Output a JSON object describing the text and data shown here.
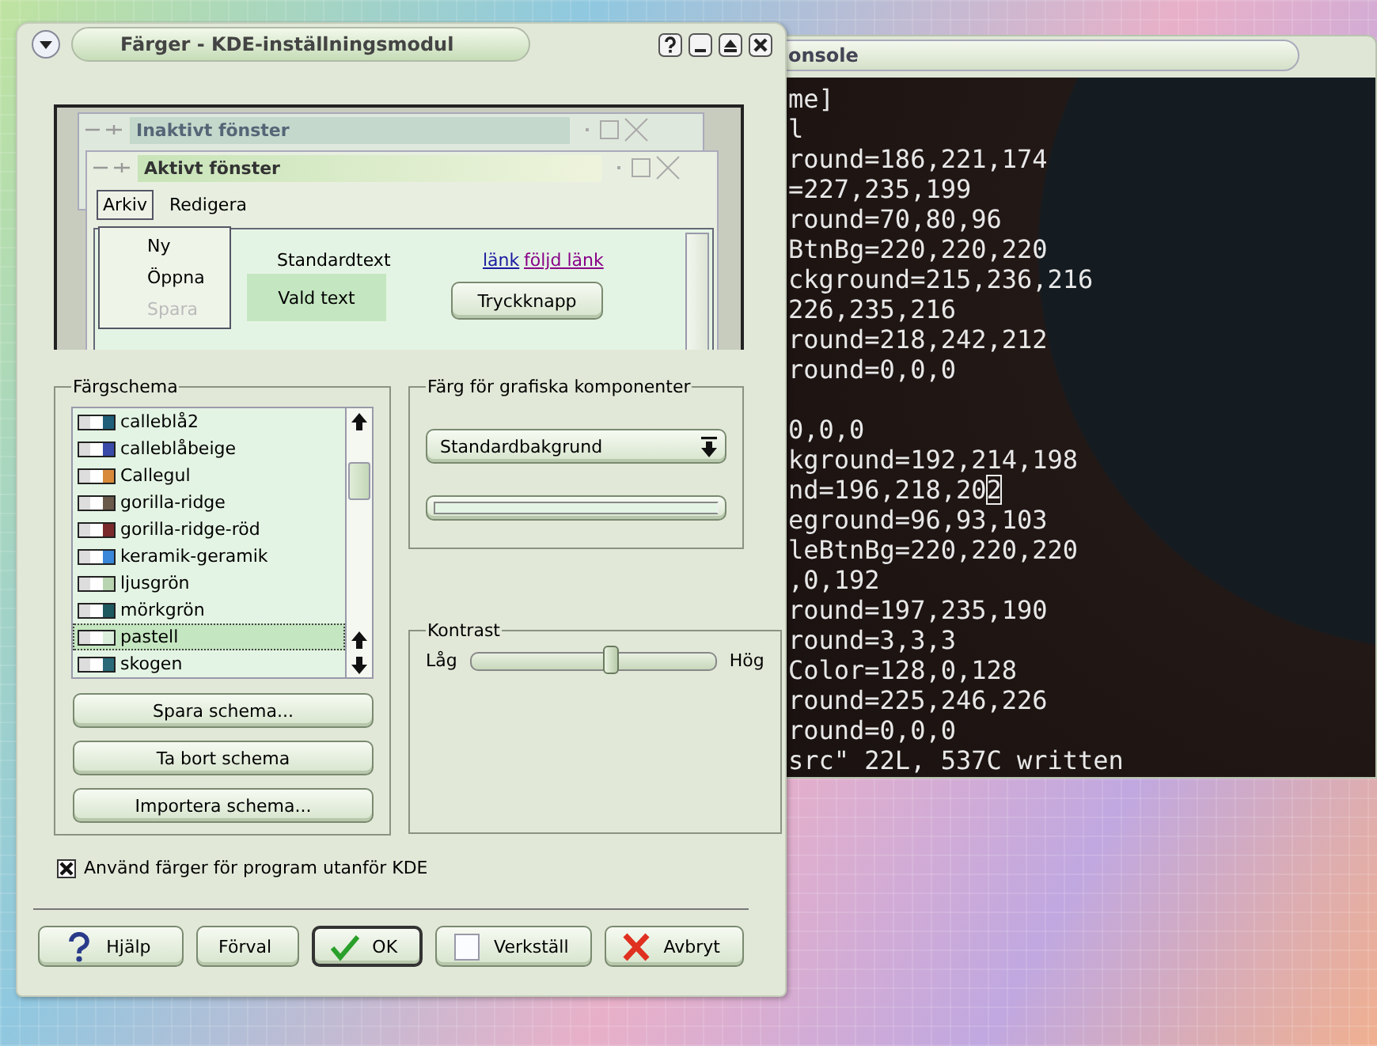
{
  "dialog": {
    "title": "Färger - KDE-inställningsmodul",
    "preview": {
      "inactive_title": "Inaktivt fönster",
      "active_title": "Aktivt fönster",
      "menu": [
        {
          "label": "Arkiv",
          "selected": true
        },
        {
          "label": "Redigera",
          "selected": false
        }
      ],
      "menu_items": [
        {
          "label": "Ny",
          "disabled": false
        },
        {
          "label": "Öppna",
          "disabled": false
        },
        {
          "label": "Spara",
          "disabled": true
        }
      ],
      "standard_text": "Standardtext",
      "selected_text": "Vald text",
      "link": "länk",
      "visited_link": "följd länk",
      "push_button": "Tryckknapp"
    },
    "scheme": {
      "title": "Färgschema",
      "items": [
        {
          "label": "calleblå2",
          "color": "#1f5f7a",
          "selected": false
        },
        {
          "label": "calleblåbeige",
          "color": "#3a4aa8",
          "selected": false
        },
        {
          "label": "Callegul",
          "color": "#d88a3a",
          "selected": false
        },
        {
          "label": "gorilla-ridge",
          "color": "#6a5a4c",
          "selected": false
        },
        {
          "label": "gorilla-ridge-röd",
          "color": "#7a2a2a",
          "selected": false
        },
        {
          "label": "keramik-geramik",
          "color": "#3a86d8",
          "selected": false
        },
        {
          "label": "ljusgrön",
          "color": "#b8d4b0",
          "selected": false
        },
        {
          "label": "mörkgrön",
          "color": "#1d5a60",
          "selected": false
        },
        {
          "label": "pastell",
          "color": "#dbeedc",
          "selected": true
        },
        {
          "label": "skogen",
          "color": "#2a6a78",
          "selected": false
        }
      ],
      "buttons": [
        "Spara schema...",
        "Ta bort schema",
        "Importera schema..."
      ]
    },
    "widget_color": {
      "title": "Färg för grafiska komponenter",
      "combo": "Standardbakgrund"
    },
    "contrast": {
      "title": "Kontrast",
      "low": "Låg",
      "high": "Hög",
      "level": 0.57
    },
    "use_colors": {
      "label": "Använd färger för program utanför KDE",
      "checked": true
    },
    "buttons": [
      {
        "label": "Hjälp",
        "kind": "help",
        "default": false
      },
      {
        "label": "Förval",
        "kind": "plain",
        "default": false
      },
      {
        "label": "OK",
        "kind": "ok",
        "default": true
      },
      {
        "label": "Verkställ",
        "kind": "apply",
        "default": false
      },
      {
        "label": "Avbryt",
        "kind": "cancel",
        "default": false
      }
    ]
  },
  "console": {
    "title": "onsole",
    "blocks": [
      [
        {
          "text": "me]"
        },
        {
          "text": "l"
        },
        {
          "text": "round=186,221,174"
        },
        {
          "text": "=227,235,199"
        },
        {
          "text": "round=70,80,96"
        },
        {
          "text": "BtnBg=220,220,220"
        },
        {
          "text": "ckground=215,236,216"
        },
        {
          "text": "226,235,216"
        },
        {
          "text": "round=218,242,212"
        },
        {
          "text": "round=0,0,0"
        }
      ],
      [
        {
          "text": "0,0,0"
        },
        {
          "text": "kground=192,214,198"
        },
        {
          "text": "nd=196,218,20",
          "cursor": "2"
        },
        {
          "text": "eground=96,93,103"
        },
        {
          "text": "leBtnBg=220,220,220"
        },
        {
          "text": ",0,192"
        },
        {
          "text": "round=197,235,190"
        },
        {
          "text": "round=3,3,3"
        },
        {
          "text": "Color=128,0,128"
        },
        {
          "text": "round=225,246,226"
        },
        {
          "text": "round=0,0,0"
        },
        {
          "text": "src\" 22L, 537C written"
        }
      ]
    ]
  }
}
